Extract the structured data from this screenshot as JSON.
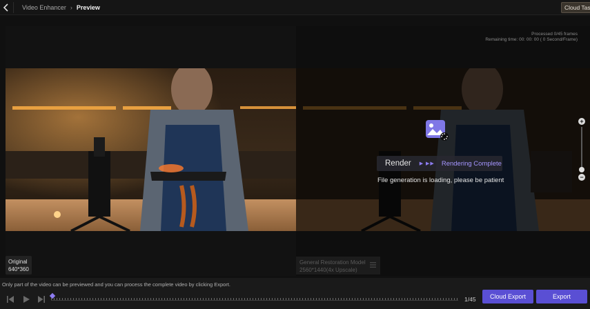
{
  "header": {
    "breadcrumb_parent": "Video Enhancer",
    "breadcrumb_current": "Preview",
    "cloud_task_label": "Cloud Task"
  },
  "preview": {
    "processed_text": "Processed 0/45 frames",
    "remaining_text": "Remaining time: 00: 00: 00 ( 0 Second/Frame)",
    "render_label": "Render",
    "render_status": "Rendering Complete",
    "loading_message": "File generation is loading, please be patient",
    "model_name": "General Restoration Model",
    "model_resolution": "2560*1440(4x Upscale)",
    "original_label": "Original",
    "original_resolution": "640*360"
  },
  "controls": {
    "notice": "Only part of the video can be previewed and you can process the complete video by clicking Export.",
    "frame_counter": "1/45",
    "progress_fraction": 0.0,
    "cloud_export_label": "Cloud Export",
    "export_label": "Export"
  },
  "colors": {
    "accent": "#5a4fd4",
    "accent_light": "#a596ff",
    "background": "#101010"
  },
  "icons": [
    "back-arrow-icon",
    "chevron-right-icon",
    "image-render-icon",
    "zoom-in-icon",
    "zoom-out-icon",
    "menu-icon",
    "skip-back-icon",
    "play-icon",
    "skip-forward-icon"
  ]
}
